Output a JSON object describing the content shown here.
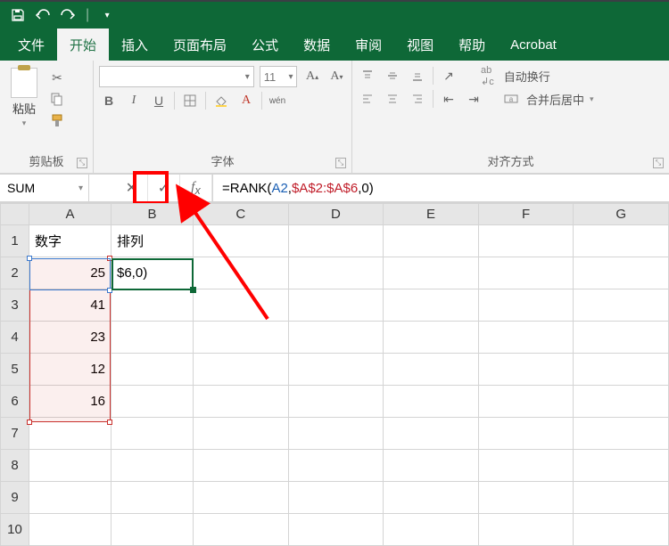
{
  "qat": {
    "save": "save",
    "undo": "undo",
    "redo": "redo"
  },
  "tabs": [
    "文件",
    "开始",
    "插入",
    "页面布局",
    "公式",
    "数据",
    "审阅",
    "视图",
    "帮助",
    "Acrobat"
  ],
  "active_tab_index": 1,
  "ribbon": {
    "clipboard": {
      "paste": "粘贴",
      "label": "剪贴板"
    },
    "font": {
      "name_placeholder": "",
      "size": "11",
      "bold": "B",
      "italic": "I",
      "underline": "U",
      "wen": "wén",
      "label": "字体"
    },
    "align": {
      "wrap": "自动换行",
      "merge": "合并后居中",
      "label": "对齐方式"
    }
  },
  "namebox": "SUM",
  "formula": {
    "prefix": "=RANK(",
    "arg1": "A2",
    "sep1": ",",
    "arg2": "$A$2:$A$6",
    "suffix": ",0)"
  },
  "columns": [
    "A",
    "B",
    "C",
    "D",
    "E",
    "F",
    "G"
  ],
  "rows": [
    {
      "n": 1,
      "A": "数字",
      "B": "排列",
      "aA": "txt",
      "aB": "txt"
    },
    {
      "n": 2,
      "A": "25",
      "B": "$6,0)",
      "aA": "num",
      "aB": "txt"
    },
    {
      "n": 3,
      "A": "41",
      "B": "",
      "aA": "num"
    },
    {
      "n": 4,
      "A": "23",
      "B": "",
      "aA": "num"
    },
    {
      "n": 5,
      "A": "12",
      "B": "",
      "aA": "num"
    },
    {
      "n": 6,
      "A": "16",
      "B": "",
      "aA": "num"
    },
    {
      "n": 7,
      "A": "",
      "B": ""
    },
    {
      "n": 8,
      "A": "",
      "B": ""
    },
    {
      "n": 9,
      "A": "",
      "B": ""
    },
    {
      "n": 10,
      "A": "",
      "B": ""
    }
  ]
}
